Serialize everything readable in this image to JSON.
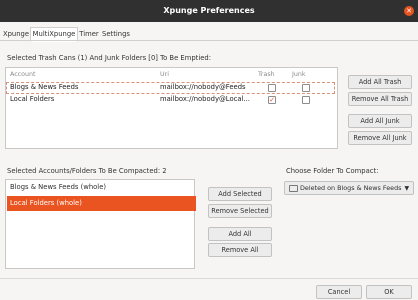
{
  "window": {
    "title": "Xpunge Preferences"
  },
  "tabs": [
    {
      "label": "Xpunge"
    },
    {
      "label": "MultiXpunge"
    },
    {
      "label": "Timer"
    },
    {
      "label": "Settings"
    }
  ],
  "trash_section": {
    "heading": "Selected Trash Cans (1) And Junk Folders [0] To Be Emptied:",
    "columns": {
      "account": "Account",
      "uri": "Uri",
      "trash": "Trash",
      "junk": "Junk"
    },
    "rows": [
      {
        "account": "Blogs & News Feeds",
        "uri": "mailbox://nobody@Feeds",
        "trash": false,
        "junk": false
      },
      {
        "account": "Local Folders",
        "uri": "mailbox://nobody@Local...",
        "trash": true,
        "junk": false
      }
    ],
    "buttons": {
      "add_all_trash": "Add All Trash",
      "remove_all_trash": "Remove All Trash",
      "add_all_junk": "Add All Junk",
      "remove_all_junk": "Remove All Junk"
    }
  },
  "compact_section": {
    "heading": "Selected Accounts/Folders To Be Compacted: 2",
    "items": [
      {
        "label": "Blogs & News Feeds (whole)",
        "selected": false
      },
      {
        "label": "Local Folders (whole)",
        "selected": true
      }
    ],
    "buttons": {
      "add_selected": "Add Selected",
      "remove_selected": "Remove Selected",
      "add_all": "Add All",
      "remove_all": "Remove All"
    },
    "choose_label": "Choose Folder To Compact:",
    "choose_value": "Deleted on Blogs & News Feeds"
  },
  "footer": {
    "cancel": "Cancel",
    "ok": "OK"
  },
  "colors": {
    "accent": "#e95420",
    "titlebar": "#303030"
  }
}
